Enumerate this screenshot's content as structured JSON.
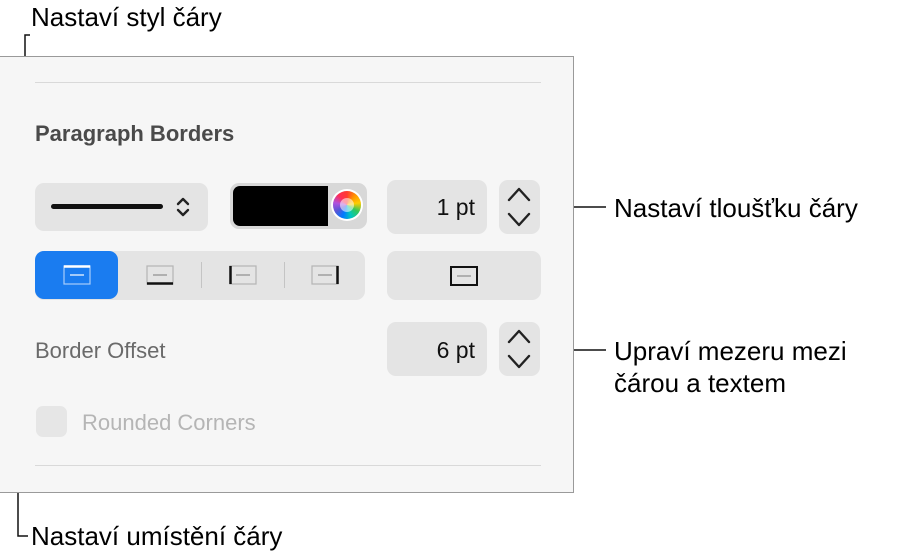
{
  "callouts": {
    "line_style": "Nastaví styl čáry",
    "line_thickness": "Nastaví tloušťku čáry",
    "border_offset_line1": "Upraví mezeru mezi",
    "border_offset_line2": "čárou a textem",
    "line_position": "Nastaví umístění čáry"
  },
  "panel": {
    "heading": "Paragraph Borders",
    "line_style_selected": "solid",
    "color_swatch": "#000000",
    "thickness_value": "1 pt",
    "border_position_options": [
      "top",
      "bottom",
      "left",
      "right",
      "box"
    ],
    "border_position_selected": "top",
    "accent_color": "#1a7cf0",
    "border_offset_label": "Border Offset",
    "border_offset_value": "6 pt",
    "rounded_corners_label": "Rounded Corners",
    "rounded_corners_checked": false,
    "rounded_corners_enabled": false
  },
  "icons": {
    "line_style_chevron": "chevron-up-down-icon",
    "color_wheel": "color-wheel-icon",
    "stepper": "stepper-up-down-icon",
    "border_top": "border-top-icon",
    "border_bottom": "border-bottom-icon",
    "border_left": "border-left-icon",
    "border_right": "border-right-icon",
    "border_box": "border-box-icon"
  }
}
